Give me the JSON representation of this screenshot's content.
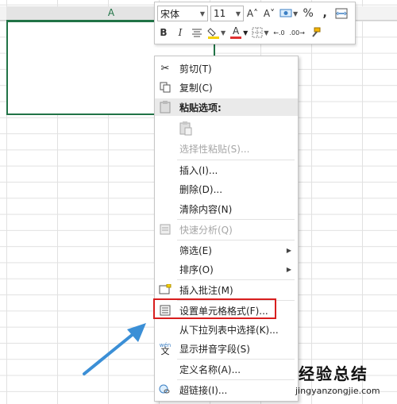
{
  "sheet": {
    "column_a_label": "A"
  },
  "toolbar": {
    "font_name": "宋体",
    "font_size": "11",
    "increase_font": "A˄",
    "decrease_font": "A˅",
    "percent": "%",
    "comma": ",",
    "bold": "B",
    "italic": "I",
    "font_color_letter": "A",
    "increase_decimal": "←.0",
    "decrease_decimal": ".00→"
  },
  "menu": {
    "cut": "剪切(T)",
    "copy": "复制(C)",
    "paste_options": "粘贴选项:",
    "paste_special": "选择性粘贴(S)...",
    "insert": "插入(I)...",
    "delete": "删除(D)...",
    "clear_contents": "清除内容(N)",
    "quick_analysis": "快速分析(Q)",
    "filter": "筛选(E)",
    "sort": "排序(O)",
    "insert_comment": "插入批注(M)",
    "format_cells": "设置单元格格式(F)...",
    "pick_from_list": "从下拉列表中选择(K)...",
    "show_phonetic": "显示拼音字段(S)",
    "define_name": "定义名称(A)...",
    "hyperlink": "超链接(I)..."
  },
  "watermark": {
    "title": "经验总结",
    "url": "jingyanzongjie.com"
  },
  "colors": {
    "excel_green": "#217346",
    "highlight_red": "#d81e1e",
    "arrow_blue": "#3b8fd6",
    "font_color_red": "#e03030",
    "fill_yellow": "#f5d000"
  }
}
